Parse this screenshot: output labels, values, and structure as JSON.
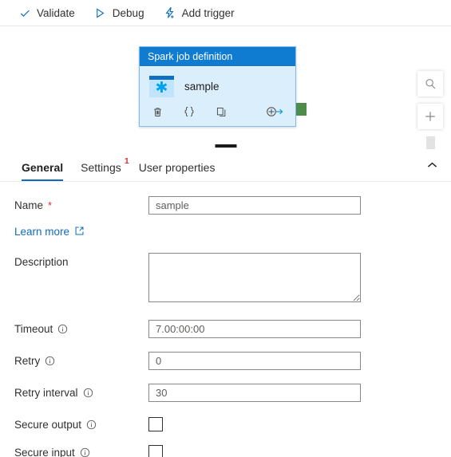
{
  "toolbar": {
    "items": [
      {
        "label": "Validate",
        "icon": "check-icon"
      },
      {
        "label": "Debug",
        "icon": "play-icon"
      },
      {
        "label": "Add trigger",
        "icon": "lightning-plus-icon"
      }
    ]
  },
  "canvas": {
    "node": {
      "header": "Spark job definition",
      "activity_name": "sample",
      "icon": "spark-asterisk-icon",
      "actions": [
        {
          "name": "delete-activity",
          "icon": "trash-icon",
          "glyph": "🗑"
        },
        {
          "name": "code-view",
          "icon": "braces-icon",
          "glyph": "{ }"
        },
        {
          "name": "clone-activity",
          "icon": "copy-icon",
          "glyph": "❐"
        },
        {
          "name": "add-output",
          "icon": "add-output-arrow-icon",
          "glyph": "⊕→"
        }
      ]
    },
    "annotation": {
      "name": "red-circle-highlight"
    },
    "port": {
      "name": "output-port",
      "color": "#4e8c4a"
    },
    "controls": [
      {
        "name": "search-canvas",
        "icon": "search-icon"
      },
      {
        "name": "zoom-in",
        "icon": "plus-icon"
      }
    ]
  },
  "panel": {
    "tabs": [
      {
        "label": "General",
        "active": true,
        "badge": ""
      },
      {
        "label": "Settings",
        "active": false,
        "badge": "1"
      },
      {
        "label": "User properties",
        "active": false,
        "badge": ""
      }
    ],
    "collapse_icon": "chevron-up-icon",
    "fields": {
      "name": {
        "label": "Name",
        "required": "*",
        "value": "sample"
      },
      "learn_more": {
        "label": "Learn more",
        "icon": "external-link-icon"
      },
      "description": {
        "label": "Description",
        "value": ""
      },
      "timeout": {
        "label": "Timeout",
        "value": "7.00:00:00",
        "info": "info-icon"
      },
      "retry": {
        "label": "Retry",
        "value": "0",
        "info": "info-icon"
      },
      "retry_interval": {
        "label": "Retry interval",
        "value": "30",
        "info": "info-icon"
      },
      "secure_output": {
        "label": "Secure output",
        "checked": false,
        "info": "info-icon"
      },
      "secure_input": {
        "label": "Secure input",
        "checked": false,
        "info": "info-icon"
      }
    }
  },
  "colors": {
    "accent": "#0f6cbd",
    "node_header": "#0f7bd1",
    "node_body": "#daeefb",
    "badge_red": "#d13438",
    "port_green": "#4e8c4a",
    "annotation_red": "#e8192c"
  }
}
